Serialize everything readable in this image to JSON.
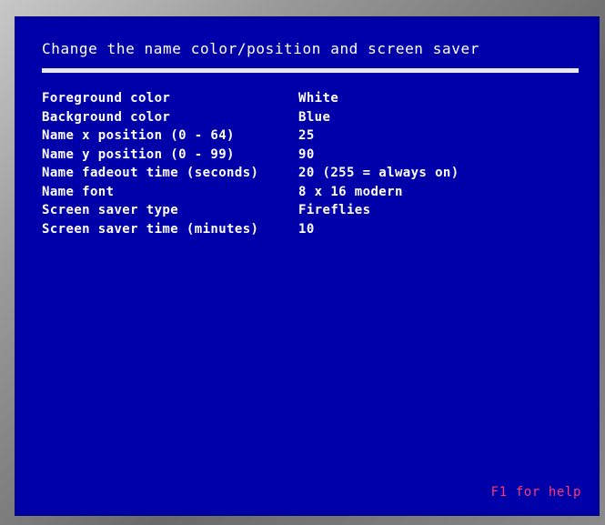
{
  "screen": {
    "title": "Change the name color/position and screen saver",
    "help_text": "F1 for help",
    "settings": [
      {
        "label": "Foreground color",
        "value": "White"
      },
      {
        "label": "Background color",
        "value": "Blue"
      },
      {
        "label": "Name x position (0 - 64)",
        "value": "25"
      },
      {
        "label": "Name y position (0 - 99)",
        "value": "90"
      },
      {
        "label": "Name fadeout time (seconds)",
        "value": "20 (255 = always on)"
      },
      {
        "label": "Name font",
        "value": "8 x 16 modern"
      },
      {
        "label": "Screen saver type",
        "value": "Fireflies"
      },
      {
        "label": "Screen saver time (minutes)",
        "value": "10"
      }
    ]
  },
  "colors": {
    "background": "#0000aa",
    "text": "#ffffff",
    "help": "#ff3a6e",
    "rule": "#e8e8f0"
  }
}
